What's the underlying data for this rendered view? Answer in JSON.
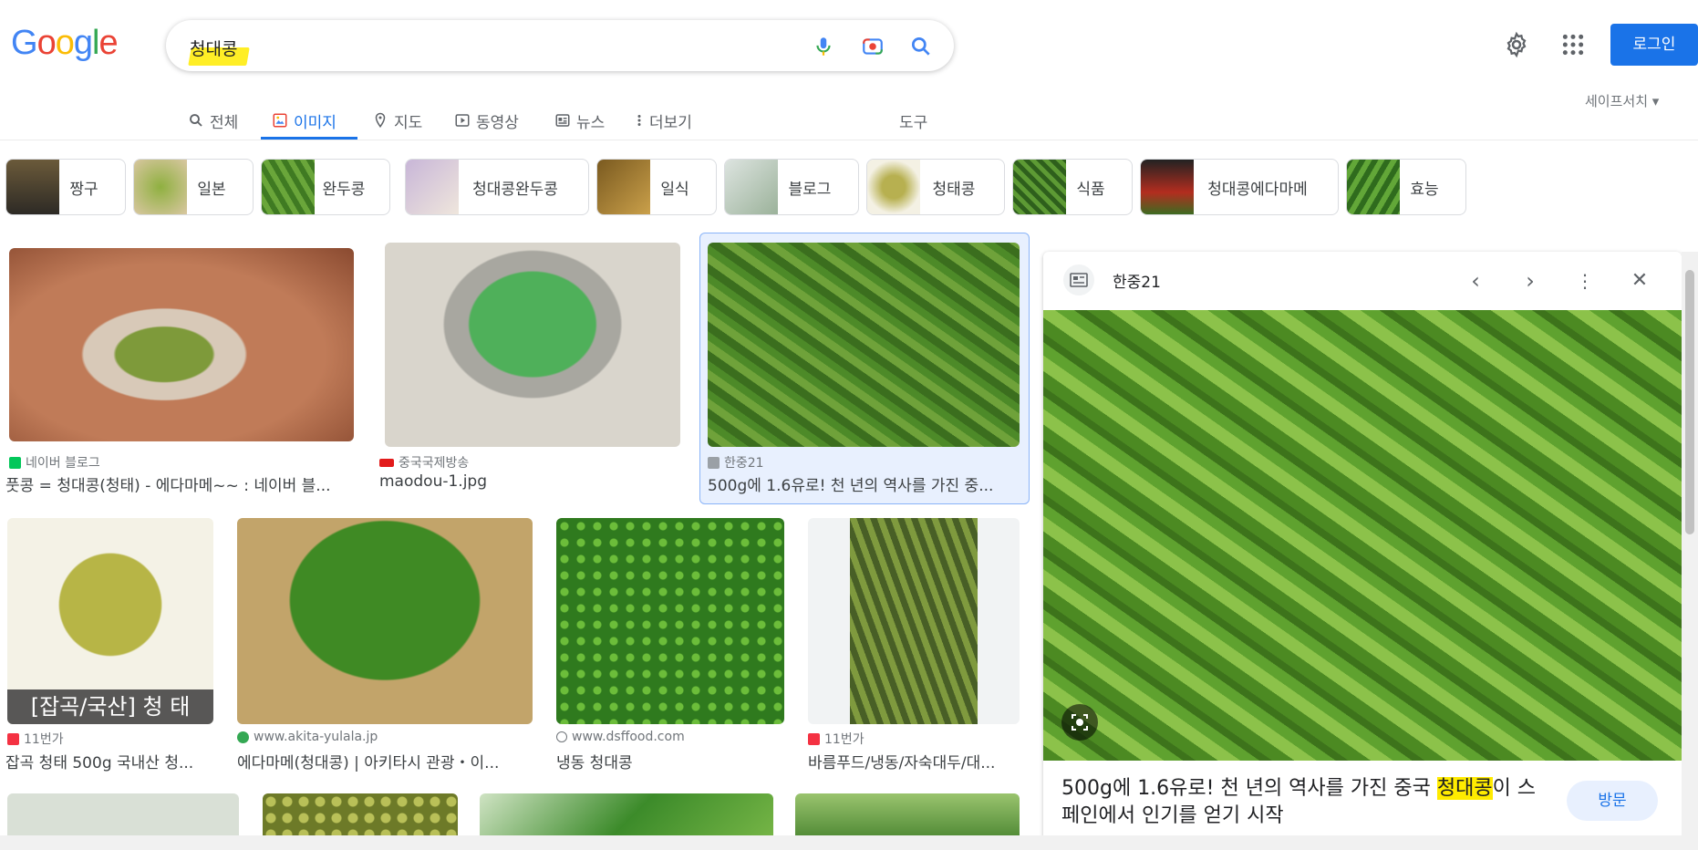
{
  "logo": {
    "letters": [
      "G",
      "o",
      "o",
      "g",
      "l",
      "e"
    ]
  },
  "search": {
    "query": "청대콩"
  },
  "header": {
    "signin_label": "로그인",
    "safesearch_label": "세이프서치 ▾"
  },
  "tabs": [
    {
      "label": "전체",
      "icon": "search-icon"
    },
    {
      "label": "이미지",
      "icon": "image-icon",
      "active": true
    },
    {
      "label": "지도",
      "icon": "pin-icon"
    },
    {
      "label": "동영상",
      "icon": "play-icon"
    },
    {
      "label": "뉴스",
      "icon": "news-icon"
    },
    {
      "label": "더보기",
      "icon": "more-vert-icon"
    }
  ],
  "tools_label": "도구",
  "chips": [
    "짱구",
    "일본",
    "완두콩",
    "청대콩완두콩",
    "일식",
    "블로그",
    "청태콩",
    "식품",
    "청대콩에다마메",
    "효능"
  ],
  "results_row1": [
    {
      "source": "네이버 블로그",
      "title": "풋콩 = 청대콩(청태) - 에다마메~~ : 네이버 블..."
    },
    {
      "source": "중국국제방송",
      "title": "maodou-1.jpg"
    },
    {
      "source": "한중21",
      "title": "500g에 1.6유로! 천 년의 역사를 가진 중..."
    }
  ],
  "results_row2": [
    {
      "source": "11번가",
      "title": "잡곡 청태 500g 국내산 청...",
      "overlay": "[잡곡/국산] 청 태"
    },
    {
      "source": "www.akita-yulala.jp",
      "title": "에다마메(청대콩) | 아키타시 관광・이..."
    },
    {
      "source": "www.dsffood.com",
      "title": "냉동 청대콩"
    },
    {
      "source": "11번가",
      "title": "바름푸드/냉동/자숙대두/대..."
    }
  ],
  "panel": {
    "source": "한중21",
    "title_before": "500g에 1.6유로! 천 년의 역사를 가진 중국 ",
    "title_highlight": "청대콩",
    "title_after": "이 스페인에서 인기를 얻기 시작",
    "visit_label": "방문"
  },
  "colors": {
    "accent": "#1a73e8",
    "highlight": "#ffeb00",
    "bean": "#6a9e2a"
  }
}
